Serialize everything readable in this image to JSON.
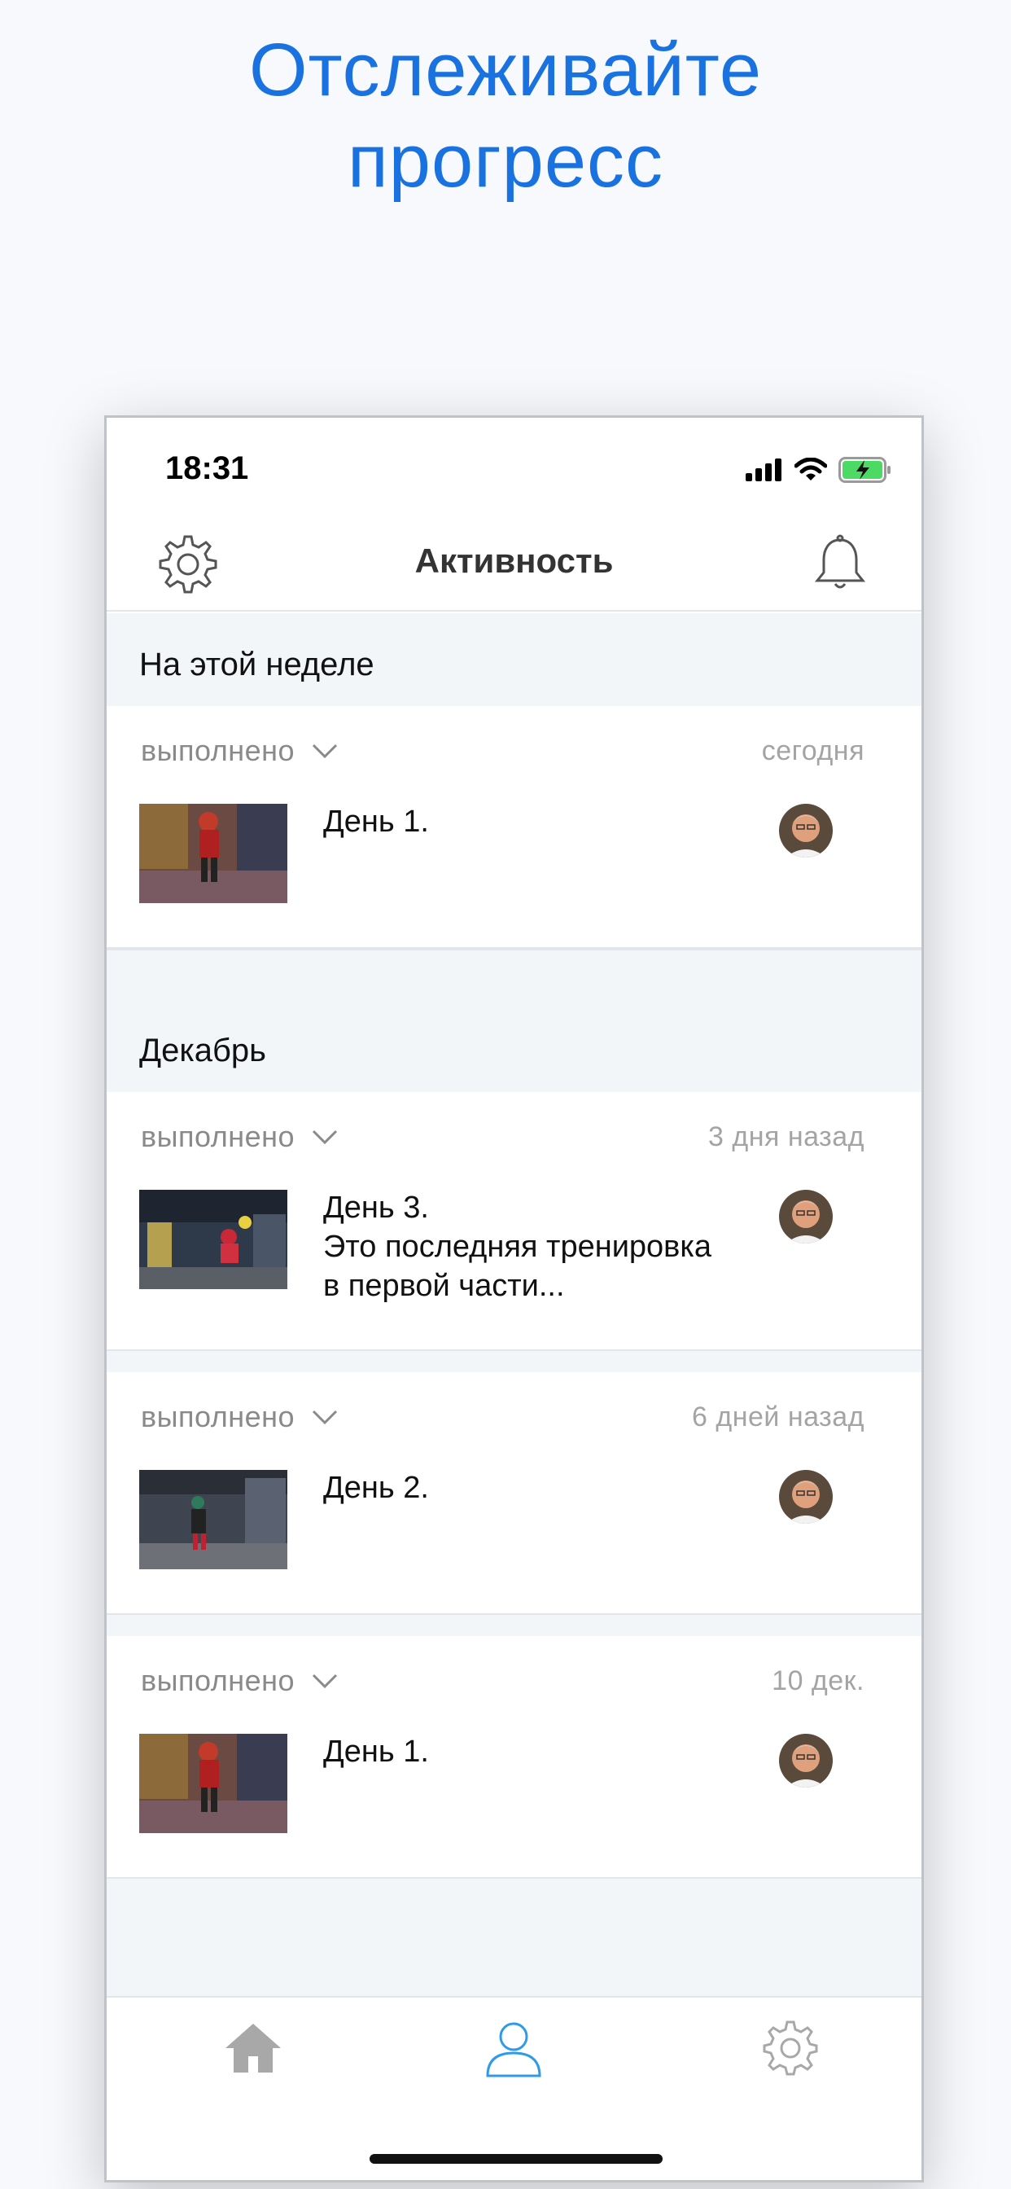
{
  "headline": {
    "line1": "Отслеживайте",
    "line2": "прогресс"
  },
  "status_bar": {
    "time": "18:31",
    "icons": [
      "signal-icon",
      "wifi-icon",
      "battery-charging-icon"
    ]
  },
  "nav": {
    "title": "Активность",
    "left_icon": "gear-icon",
    "right_icon": "bell-icon"
  },
  "sections": [
    {
      "title": "На этой неделе",
      "items": [
        {
          "status": "выполнено",
          "date": "сегодня",
          "text_lines": [
            "День 1."
          ]
        }
      ]
    },
    {
      "title": "Декабрь",
      "items": [
        {
          "status": "выполнено",
          "date": "3 дня назад",
          "text_lines": [
            "День 3.",
            "Это последняя тренировка",
            "в первой части..."
          ]
        },
        {
          "status": "выполнено",
          "date": "6 дней назад",
          "text_lines": [
            "День 2."
          ]
        },
        {
          "status": "выполнено",
          "date": "10 дек.",
          "text_lines": [
            "День 1."
          ]
        }
      ]
    }
  ],
  "tab_bar": {
    "tabs": [
      {
        "icon": "home-icon",
        "active": false
      },
      {
        "icon": "profile-icon",
        "active": true
      },
      {
        "icon": "gear-icon",
        "active": false
      }
    ],
    "active_color": "#2f9be8",
    "inactive_color": "#a8a8a8"
  },
  "colors": {
    "accent": "#1a72e0",
    "section_bg": "#f3f6f9"
  }
}
